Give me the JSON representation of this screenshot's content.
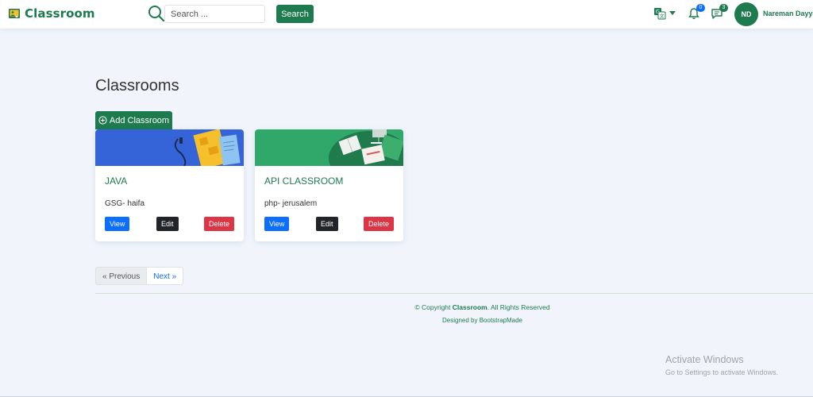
{
  "brand": {
    "name": "Classroom",
    "color": "#1e7a4f"
  },
  "header": {
    "search_placeholder": "Search ...",
    "search_button": "Search",
    "translate_icon": "translate-icon",
    "notifications_count": "0",
    "messages_count": "3",
    "user_initials": "ND",
    "user_name": "Nareman Dayya"
  },
  "main": {
    "title": "Classrooms",
    "add_button": "Add Classroom",
    "classrooms": [
      {
        "name": "JAVA",
        "subtitle": "GSG- haifa",
        "banner_color": "#3564d8",
        "view": "View",
        "edit": "Edit",
        "delete": "Delete"
      },
      {
        "name": "API CLASSROOM",
        "subtitle": "php- jerusalem",
        "banner_color": "#2fa86a",
        "view": "View",
        "edit": "Edit",
        "delete": "Delete"
      }
    ]
  },
  "pagination": {
    "previous": "« Previous",
    "next": "Next »"
  },
  "footer": {
    "copyright_prefix": "© Copyright ",
    "copyright_brand": "Classroom",
    "copyright_suffix": ". All Rights Reserved",
    "designed_by": "Designed by ",
    "designer": "BootstrapMade"
  },
  "windows_watermark": {
    "title": "Activate Windows",
    "subtitle": "Go to Settings to activate Windows."
  },
  "colors": {
    "primary": "#1e7a4f",
    "view": "#0d6efd",
    "edit": "#212529",
    "delete": "#dc3545",
    "background": "#f1f5fb"
  }
}
